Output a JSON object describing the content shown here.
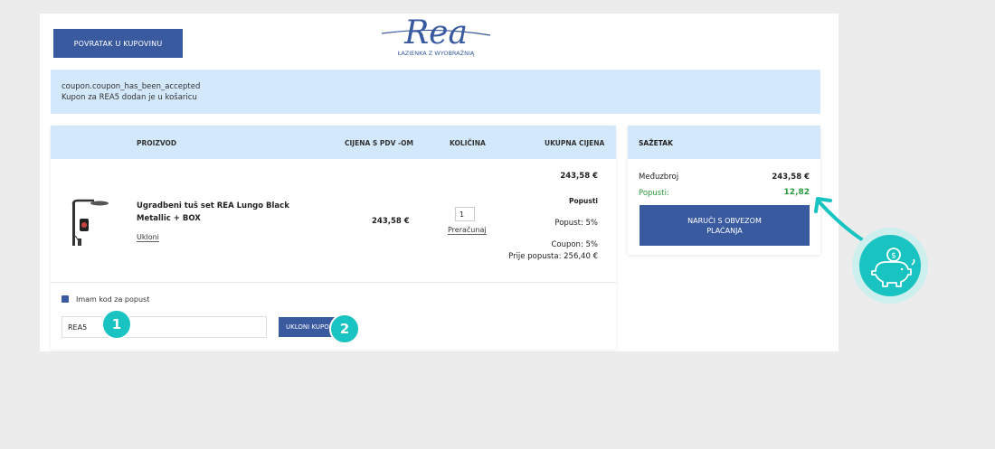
{
  "header": {
    "back_button": "POVRATAK U KUPOVINU",
    "logo_text": "Rea",
    "logo_tagline": "ŁAZIENKA Z WYOBRAŹNIĄ"
  },
  "alert": {
    "line1": "coupon.coupon_has_been_accepted",
    "line2": "Kupon za REA5 dodan je u košaricu"
  },
  "cart": {
    "columns": {
      "product": "PROIZVOD",
      "price": "CIJENA S PDV -OM",
      "quantity": "KOLIČINA",
      "total": "UKUPNA CIJENA"
    },
    "item": {
      "image_icon": "shower-set-icon",
      "name": "Ugradbeni tuš set REA Lungo Black Metallic + BOX",
      "remove": "Ukloni",
      "unit_price": "243,58 €",
      "quantity": "1",
      "recalc": "Preračunaj",
      "total": "243,58 €",
      "discounts_label": "Popusti",
      "discount_line": "Popust: 5%",
      "coupon_line": "Coupon: 5%",
      "before_discount": "Prije popusta: 256,40 €"
    },
    "coupon": {
      "checkbox_label": "Imam kod za popust",
      "code_value": "REA5",
      "remove_button": "UKLONI KUPON",
      "badge1": "1",
      "badge2": "2"
    }
  },
  "summary": {
    "title": "SAŽETAK",
    "subtotal_label": "Međuzbroj",
    "subtotal_value": "243,58 €",
    "discount_label": "Popusti:",
    "discount_value": "12,82",
    "order_button": "NARUČI S OBVEZOM PLAĆANJA"
  },
  "colors": {
    "primary": "#3a5aa0",
    "header_bg": "#d3e8fb",
    "accent_teal": "#18c3c1",
    "discount_green": "#2e9b3e"
  }
}
